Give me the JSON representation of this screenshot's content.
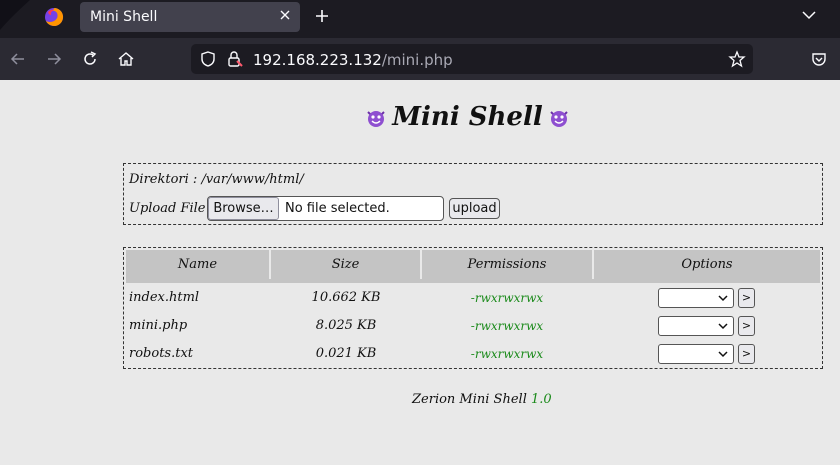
{
  "browser": {
    "tab_title": "Mini Shell",
    "url_host": "192.168.223.132",
    "url_path": "/mini.php"
  },
  "page": {
    "title": "Mini Shell",
    "directory_label": "Direktori :",
    "directory_path": "/var/www/html/",
    "upload_label": "Upload File :",
    "browse_label": "Browse…",
    "no_file_text": "No file selected.",
    "upload_button": "upload",
    "table": {
      "headers": [
        "Name",
        "Size",
        "Permissions",
        "Options"
      ],
      "rows": [
        {
          "name": "index.html",
          "size": "10.662 KB",
          "perms": "-rwxrwxrwx",
          "go": ">"
        },
        {
          "name": "mini.php",
          "size": "8.025 KB",
          "perms": "-rwxrwxrwx",
          "go": ">"
        },
        {
          "name": "robots.txt",
          "size": "0.021 KB",
          "perms": "-rwxrwxrwx",
          "go": ">"
        }
      ]
    },
    "footer_text": "Zerion Mini Shell",
    "footer_version": "1.0"
  },
  "colors": {
    "tabbar_bg": "#1c1b22",
    "navbar_bg": "#2b2a33",
    "page_bg": "#e9e9e9",
    "header_cell_bg": "#c4c4c4",
    "permission_green": "#1a8a1a"
  },
  "icons": [
    "firefox-icon",
    "close-icon",
    "plus-icon",
    "chevron-down-icon",
    "back-arrow-icon",
    "forward-arrow-icon",
    "reload-icon",
    "home-icon",
    "shield-icon",
    "lock-warning-icon",
    "star-icon",
    "pocket-icon",
    "devil-icon"
  ]
}
